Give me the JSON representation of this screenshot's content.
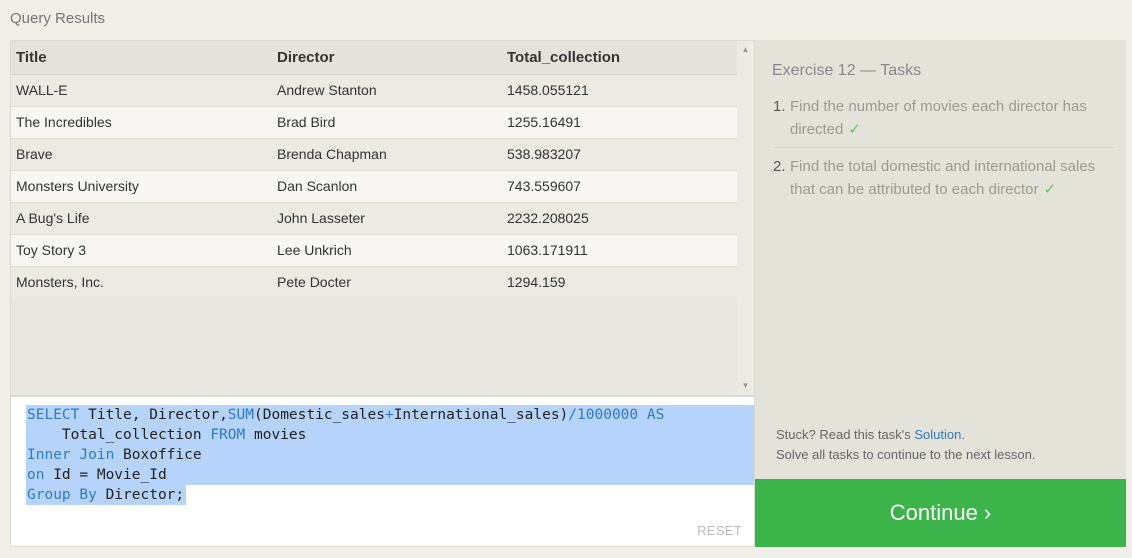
{
  "header": {
    "title": "Query Results"
  },
  "table": {
    "columns": [
      "Title",
      "Director",
      "Total_collection"
    ],
    "rows": [
      [
        "WALL-E",
        "Andrew Stanton",
        "1458.055121"
      ],
      [
        "The Incredibles",
        "Brad Bird",
        "1255.16491"
      ],
      [
        "Brave",
        "Brenda Chapman",
        "538.983207"
      ],
      [
        "Monsters University",
        "Dan Scanlon",
        "743.559607"
      ],
      [
        "A Bug's Life",
        "John Lasseter",
        "2232.208025"
      ],
      [
        "Toy Story 3",
        "Lee Unkrich",
        "1063.171911"
      ],
      [
        "Monsters, Inc.",
        "Pete Docter",
        "1294.159"
      ]
    ]
  },
  "editor": {
    "l1_kw1": "SELECT",
    "l1_t1": " Title, Director,",
    "l1_kw2": "SUM",
    "l1_t2": "(Domestic_sales",
    "l1_op1": "+",
    "l1_t3": "International_sales)",
    "l1_op2": "/1000000",
    "l1_kw3": " AS",
    "l2_t1": "    Total_collection ",
    "l2_kw1": "FROM",
    "l2_t2": " movies",
    "l3_kw1": "Inner Join",
    "l3_t1": " Boxoffice",
    "l4_kw1": "on",
    "l4_t1": " Id = Movie_Id",
    "l5_kw1": "Group By",
    "l5_t1": " Director;",
    "reset_label": "RESET"
  },
  "tasks": {
    "heading": "Exercise 12 — Tasks",
    "items": [
      {
        "num": "1.",
        "text": "Find the number of movies each director has directed",
        "check": "✓"
      },
      {
        "num": "2.",
        "text": "Find the total domestic and international sales that can be attributed to each director",
        "check": "✓"
      }
    ],
    "stuck_prefix": "Stuck? Read this task's ",
    "solution_link": "Solution",
    "stuck_suffix": ".",
    "hint": "Solve all tasks to continue to the next lesson."
  },
  "continue_label": "Continue ›",
  "icons": {
    "scroll_up": "scroll-up-arrow-icon",
    "scroll_down": "scroll-down-arrow-icon"
  }
}
